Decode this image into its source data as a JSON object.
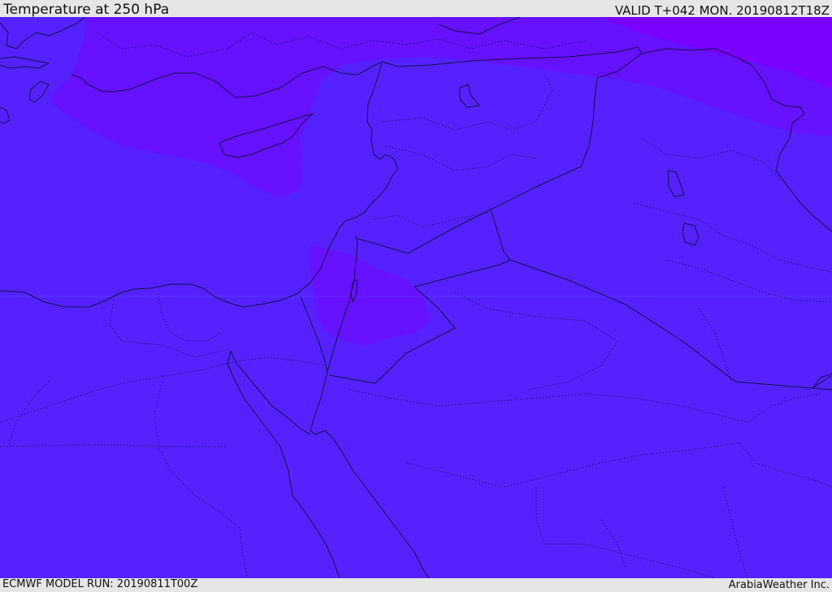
{
  "header": {
    "title": "Temperature at 250 hPa",
    "valid": "VALID T+042 MON. 20190812T18Z"
  },
  "footer": {
    "model_run": "ECMWF MODEL RUN: 20190811T00Z",
    "credit": "ArabiaWeather Inc."
  },
  "colors": {
    "base_field": "#5522ff",
    "cool_field": "#6611ff",
    "coldest_field": "#7a00ff",
    "border_line": "#1a0c4a",
    "frame": "#e6e6e6"
  }
}
